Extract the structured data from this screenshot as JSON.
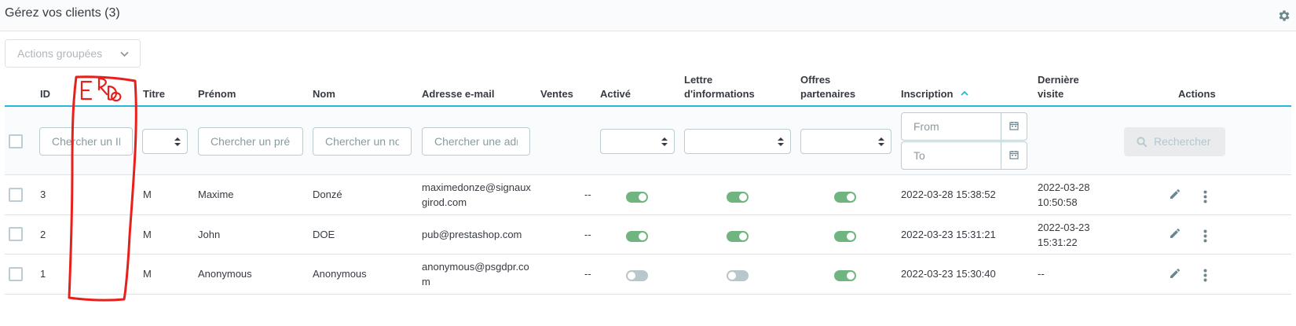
{
  "page": {
    "title": "Gérez vos clients (3)"
  },
  "bulk_actions": {
    "label": "Actions groupées"
  },
  "columns": {
    "id": "ID",
    "title": "Titre",
    "firstname": "Prénom",
    "lastname": "Nom",
    "email": "Adresse e-mail",
    "sales": "Ventes",
    "active": "Activé",
    "newsletter_1": "Lettre",
    "newsletter_2": "d'informations",
    "partner_1": "Offres",
    "partner_2": "partenaires",
    "registration": "Inscription",
    "last_visit_1": "Dernière",
    "last_visit_2": "visite",
    "actions": "Actions"
  },
  "filters": {
    "id_placeholder": "Chercher un ID",
    "firstname_placeholder": "Chercher un prénom",
    "lastname_placeholder": "Chercher un nom",
    "email_placeholder": "Chercher une adresse e-mail",
    "date_from_placeholder": "From",
    "date_to_placeholder": "To",
    "search_label": "Rechercher"
  },
  "rows": [
    {
      "id": "3",
      "title": "M",
      "firstname": "Maxime",
      "lastname": "Donzé",
      "email_1": "maximedonze@signaux",
      "email_2": "girod.com",
      "sales": "--",
      "active": true,
      "newsletter": true,
      "partner": true,
      "registration": "2022-03-28 15:38:52",
      "last_visit_1": "2022-03-28",
      "last_visit_2": "10:50:58"
    },
    {
      "id": "2",
      "title": "M",
      "firstname": "John",
      "lastname": "DOE",
      "email_1": "pub@prestashop.com",
      "email_2": "",
      "sales": "--",
      "active": true,
      "newsletter": true,
      "partner": true,
      "registration": "2022-03-23 15:31:21",
      "last_visit_1": "2022-03-23",
      "last_visit_2": "15:31:22"
    },
    {
      "id": "1",
      "title": "M",
      "firstname": "Anonymous",
      "lastname": "Anonymous",
      "email_1": "anonymous@psgdpr.co",
      "email_2": "m",
      "sales": "--",
      "active": false,
      "newsletter": false,
      "partner": true,
      "registration": "2022-03-23 15:30:40",
      "last_visit_1": "--",
      "last_visit_2": ""
    }
  ],
  "colors": {
    "accent": "#25b9d7",
    "switch_on": "#70b580",
    "switch_off": "#b8c7cc",
    "annotation": "#e8201c"
  },
  "icons": {
    "settings": "gear-icon",
    "edit": "pencil-icon",
    "more": "vertical-dots-icon",
    "calendar": "calendar-icon",
    "search": "search-icon",
    "sort": "sort-up-icon"
  }
}
